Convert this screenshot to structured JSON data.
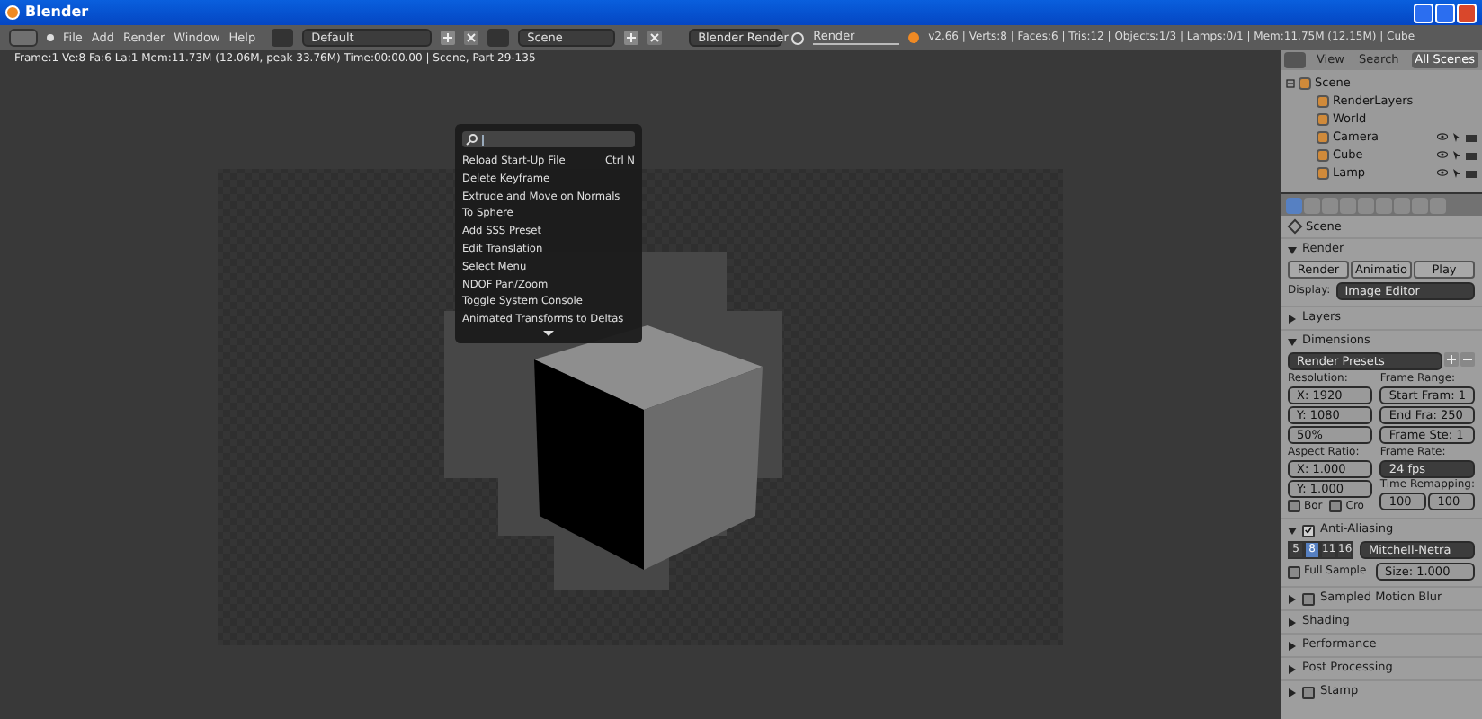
{
  "window": {
    "title": "Blender"
  },
  "menu": [
    "File",
    "Add",
    "Render",
    "Window",
    "Help"
  ],
  "layout_field": "Default",
  "scene_field": "Scene",
  "engine": "Blender Render",
  "render_field": "Render",
  "stats": "v2.66 | Verts:8 | Faces:6 | Tris:12 | Objects:1/3 | Lamps:0/1 | Mem:11.75M (12.15M) | Cube",
  "viewport": {
    "info": "Frame:1 Ve:8 Fa:6 La:1 Mem:11.73M (12.06M, peak 33.76M) Time:00:00.00 | Scene, Part 29-135"
  },
  "search_menu": {
    "items": [
      {
        "label": "Reload Start-Up File",
        "shortcut": "Ctrl N"
      },
      {
        "label": "Delete Keyframe"
      },
      {
        "label": "Extrude and Move on Normals"
      },
      {
        "label": "To Sphere"
      },
      {
        "label": "Add SSS Preset"
      },
      {
        "label": "Edit Translation"
      },
      {
        "label": "Select Menu"
      },
      {
        "label": "NDOF Pan/Zoom"
      },
      {
        "label": "Toggle System Console"
      },
      {
        "label": "Animated Transforms to Deltas"
      }
    ]
  },
  "outliner": {
    "header": [
      {
        "label": "View",
        "selected": false
      },
      {
        "label": "Search",
        "selected": false
      },
      {
        "label": "All Scenes",
        "selected": true
      }
    ],
    "tree": [
      {
        "label": "Scene",
        "expanded": true,
        "children": [
          {
            "label": "RenderLayers"
          },
          {
            "label": "World"
          },
          {
            "label": "Camera"
          },
          {
            "label": "Cube"
          },
          {
            "label": "Lamp"
          }
        ]
      }
    ]
  },
  "properties": {
    "tabs": [
      {
        "selected": true
      },
      {
        "selected": false
      },
      {
        "selected": false
      },
      {
        "selected": false
      },
      {
        "selected": false
      },
      {
        "selected": false
      },
      {
        "selected": false
      },
      {
        "selected": false
      },
      {
        "selected": false
      }
    ],
    "breadcrumb": "Scene",
    "panels": [
      {
        "title": "Render",
        "expanded": true,
        "kind": "render",
        "buttons": [
          "Render",
          "Animatio",
          "Play"
        ],
        "display_label": "Display:",
        "display_value": "Image Editor"
      },
      {
        "title": "Layers",
        "expanded": false
      },
      {
        "title": "Dimensions",
        "expanded": true,
        "kind": "dimensions",
        "presets": "Render Presets",
        "resolution_label": "Resolution:",
        "res_x": "X: 1920",
        "res_y": "Y: 1080",
        "res_pct": "50%",
        "frame_range_label": "Frame Range:",
        "start": "Start Fram: 1",
        "end": "End Fra: 250",
        "step": "Frame Ste: 1",
        "aspect_label": "Aspect Ratio:",
        "aspect_x": "X: 1.000",
        "aspect_y": "Y: 1.000",
        "border": {
          "label": "Bor",
          "checked": false
        },
        "crop": {
          "label": "Cro",
          "checked": false
        },
        "frame_rate_label": "Frame Rate:",
        "frame_rate": "24 fps",
        "remap_label": "Time Remapping:",
        "remap_old": "100",
        "remap_new": "100"
      },
      {
        "title": "Anti-Aliasing",
        "expanded": true,
        "checked": true,
        "kind": "aa",
        "samples": [
          {
            "label": "5",
            "selected": false
          },
          {
            "label": "8",
            "selected": true
          },
          {
            "label": "11",
            "selected": false
          },
          {
            "label": "16",
            "selected": false
          }
        ],
        "filter": "Mitchell-Netra",
        "full_sample": {
          "label": "Full Sample",
          "checked": false
        },
        "size": "Size: 1.000"
      },
      {
        "title": "Sampled Motion Blur",
        "expanded": false,
        "checked": false
      },
      {
        "title": "Shading",
        "expanded": false
      },
      {
        "title": "Performance",
        "expanded": false
      },
      {
        "title": "Post Processing",
        "expanded": false
      },
      {
        "title": "Stamp",
        "expanded": false,
        "checked": false
      }
    ]
  }
}
